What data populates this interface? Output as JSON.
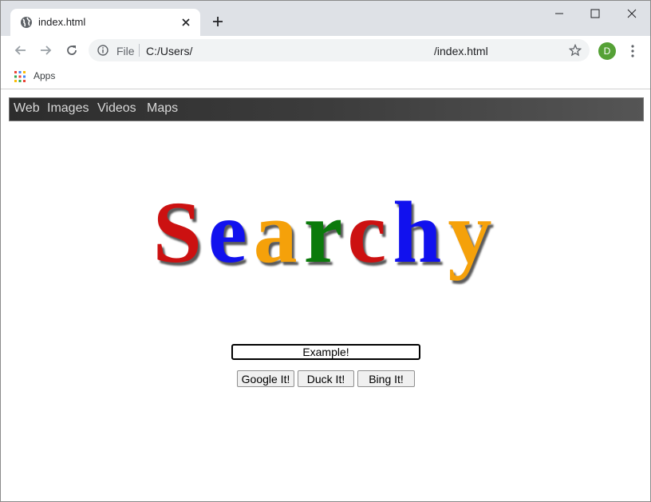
{
  "browser": {
    "tab": {
      "title": "index.html",
      "favicon": "globe-icon"
    },
    "window_controls": [
      "minimize-icon",
      "maximize-icon",
      "close-icon"
    ],
    "address_bar": {
      "scheme_label": "File",
      "url_part_1": "C:/Users/",
      "url_part_2": "/index.html"
    },
    "profile_initial": "D",
    "bookmarks": [
      {
        "label": "Apps",
        "icon": "apps-grid-icon"
      }
    ]
  },
  "page": {
    "nav": [
      "Web",
      "Images",
      "Videos",
      "Maps"
    ],
    "logo": {
      "letters": [
        "S",
        "e",
        "a",
        "r",
        "c",
        "h",
        "y"
      ],
      "colors": [
        "#cc1111",
        "#1111ee",
        "#f5a10a",
        "#0b7a0b",
        "#cc1111",
        "#1111ee",
        "#f5a10a"
      ]
    },
    "search": {
      "value": "Example!"
    },
    "buttons": [
      "Google It!",
      "Duck It!",
      "Bing It!"
    ]
  },
  "colors": {
    "tabstrip": "#dee1e6",
    "navbar": "#3c3c3c",
    "avatar": "#55a136"
  }
}
